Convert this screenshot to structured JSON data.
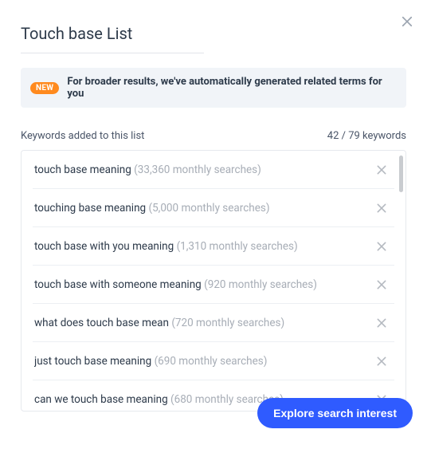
{
  "modal": {
    "title": "Touch base List"
  },
  "banner": {
    "badge": "NEW",
    "text": "For broader results, we've automatically generated related terms for you"
  },
  "list_header": {
    "label": "Keywords added to this list",
    "count_text": "42 / 79 keywords"
  },
  "keywords": [
    {
      "term": "touch base meaning",
      "meta": "(33,360 monthly searches)"
    },
    {
      "term": "touching base meaning",
      "meta": "(5,000 monthly searches)"
    },
    {
      "term": "touch base with you meaning",
      "meta": "(1,310 monthly searches)"
    },
    {
      "term": "touch base with someone meaning",
      "meta": "(920 monthly searches)"
    },
    {
      "term": "what does touch base mean",
      "meta": "(720 monthly searches)"
    },
    {
      "term": "just touch base meaning",
      "meta": "(690 monthly searches)"
    },
    {
      "term": "can we touch base meaning",
      "meta": "(680 monthly searches)"
    }
  ],
  "cta": {
    "label": "Explore search interest"
  }
}
